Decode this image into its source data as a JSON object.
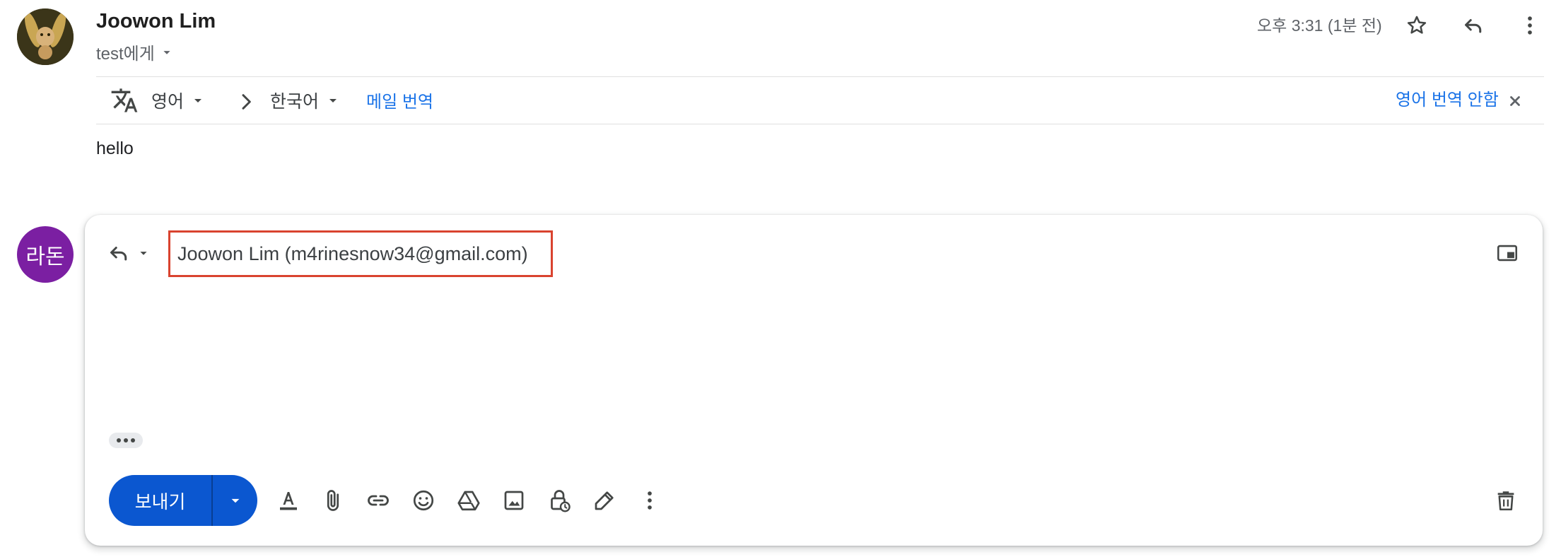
{
  "header": {
    "sender_name": "Joowon Lim",
    "recipient_label": "test에게",
    "timestamp": "오후 3:31 (1분 전)"
  },
  "translation_bar": {
    "source_language": "영어",
    "target_language": "한국어",
    "translate_label": "메일 번역",
    "dont_translate_label": "영어 번역 안함"
  },
  "message": {
    "body": "hello"
  },
  "composer": {
    "avatar_initials": "라돈",
    "recipient": "Joowon Lim (m4rinesnow34@gmail.com)",
    "send_label": "보내기"
  },
  "colors": {
    "accent": "#0b57d0",
    "link": "#1a73e8",
    "avatar_bg": "#7b1fa2",
    "highlight_border": "#d9432f"
  },
  "icons": {
    "header": [
      "star-icon",
      "reply-icon",
      "more-vert-icon"
    ],
    "composer_toolbar": [
      "format-text-icon",
      "attach-icon",
      "link-icon",
      "emoji-icon",
      "drive-icon",
      "photo-icon",
      "confidential-icon",
      "signature-icon",
      "more-options-icon",
      "trash-icon"
    ]
  }
}
